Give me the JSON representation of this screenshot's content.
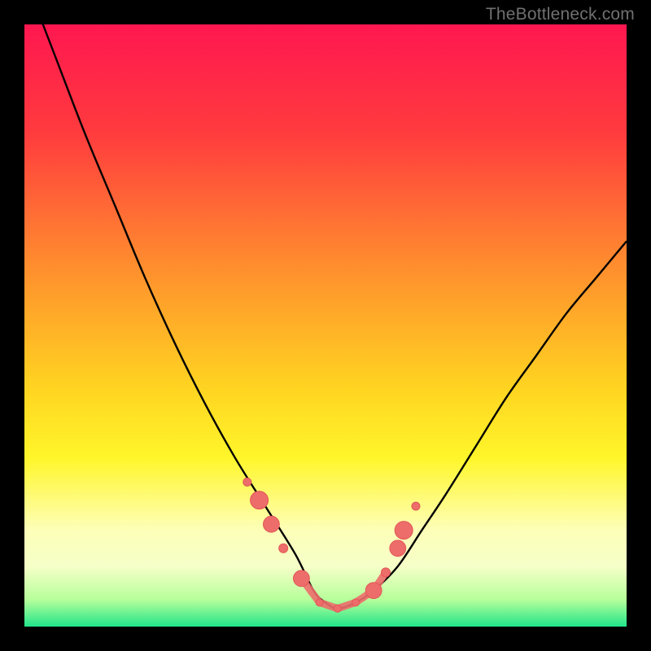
{
  "watermark": "TheBottleneck.com",
  "chart_data": {
    "type": "line",
    "title": "",
    "xlabel": "",
    "ylabel": "",
    "xlim": [
      0,
      100
    ],
    "ylim": [
      0,
      100
    ],
    "series": [
      {
        "name": "bottleneck-curve",
        "x": [
          0,
          5,
          10,
          15,
          20,
          25,
          30,
          35,
          40,
          45,
          48,
          50,
          52,
          55,
          58,
          62,
          66,
          70,
          75,
          80,
          85,
          90,
          95,
          100
        ],
        "y": [
          108,
          95,
          82,
          70,
          58,
          47,
          37,
          28,
          20,
          12,
          6,
          4,
          3,
          4,
          6,
          10,
          16,
          22,
          30,
          38,
          45,
          52,
          58,
          64
        ]
      },
      {
        "name": "marker-points",
        "x": [
          37,
          39,
          41,
          43,
          46,
          49,
          52,
          55,
          58,
          60,
          62,
          63,
          65
        ],
        "y": [
          24,
          21,
          17,
          13,
          8,
          4,
          3,
          4,
          6,
          9,
          13,
          16,
          20
        ]
      }
    ],
    "gradient_stops": [
      {
        "offset": 0.0,
        "color": "#ff1750"
      },
      {
        "offset": 0.18,
        "color": "#ff3b3e"
      },
      {
        "offset": 0.4,
        "color": "#ff8d2e"
      },
      {
        "offset": 0.6,
        "color": "#ffd321"
      },
      {
        "offset": 0.72,
        "color": "#fff62a"
      },
      {
        "offset": 0.84,
        "color": "#fdffb8"
      },
      {
        "offset": 0.9,
        "color": "#f6ffc8"
      },
      {
        "offset": 0.955,
        "color": "#b7ff9a"
      },
      {
        "offset": 1.0,
        "color": "#22e58b"
      }
    ],
    "marker_style": {
      "fill": "#ed6d6b",
      "stroke": "#e25655",
      "r_small": 5,
      "r_large": 11
    },
    "curve_stroke": "#000000"
  }
}
